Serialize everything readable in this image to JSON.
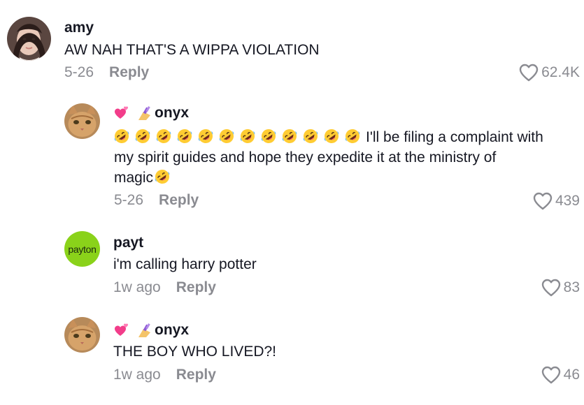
{
  "comments": [
    {
      "username": "amy",
      "text": "AW NAH THAT'S A WIPPA VIOLATION",
      "date": "5-26",
      "reply_label": "Reply",
      "likes": "62.4K",
      "avatar": "photo"
    },
    {
      "username": "onyx",
      "text_line1": "I'll be filing a complaint with",
      "text_line2": "my spirit guides and hope they expedite it at the ministry of",
      "text_line3": "magic",
      "date": "5-26",
      "reply_label": "Reply",
      "likes": "439",
      "avatar": "cat-photo",
      "leading_emoji_count": 12
    },
    {
      "username": "payt",
      "text": "i'm calling harry potter",
      "date": "1w ago",
      "reply_label": "Reply",
      "likes": "83",
      "avatar_text": "payton",
      "avatar_color": "#8ad21a"
    },
    {
      "username": "onyx",
      "text": "THE BOY WHO LIVED?!",
      "date": "1w ago",
      "reply_label": "Reply",
      "likes": "46",
      "avatar": "cat-photo"
    }
  ],
  "icons": {
    "like": "heart-outline-icon",
    "username_badges": [
      "sparkling-hearts-emoji",
      "nail-polish-emoji"
    ],
    "laugh_emoji": "rolling-on-floor-laughing-emoji"
  },
  "colors": {
    "text": "#161823",
    "muted": "#8a8b91",
    "payton_avatar": "#8ad21a"
  }
}
